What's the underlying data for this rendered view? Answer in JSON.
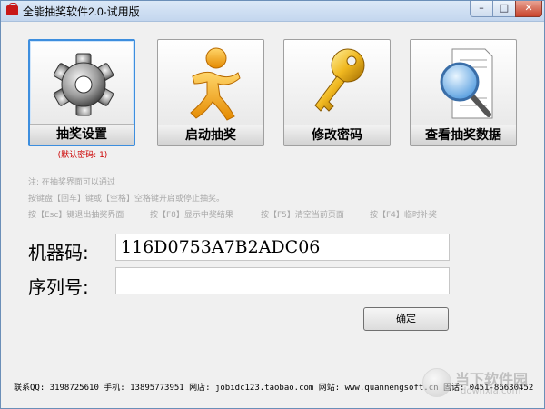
{
  "window": {
    "title": "全能抽奖软件2.0-试用版",
    "controls": {
      "minimize": "–",
      "maximize": "□",
      "close": "✕"
    }
  },
  "tiles": [
    {
      "label": "抽奖设置",
      "icon": "gear-icon",
      "selected": true
    },
    {
      "label": "启动抽奖",
      "icon": "running-man-icon"
    },
    {
      "label": "修改密码",
      "icon": "key-icon"
    },
    {
      "label": "查看抽奖数据",
      "icon": "magnifier-document-icon"
    }
  ],
  "default_password_hint": "(默认密码: 1)",
  "notes": {
    "line1": "注: 在抽奖界面可以通过",
    "line2": "按键盘【回车】键或【空格】空格键开启或停止抽奖。",
    "shortcuts": [
      "按【Esc】键退出抽奖界面",
      "按【F8】显示中奖结果",
      "按【F5】清空当前页面",
      "按【F4】临时补奖"
    ]
  },
  "form": {
    "machine_code_label": "机器码:",
    "machine_code_value": "116D0753A7B2ADC06",
    "serial_label": "序列号:",
    "serial_value": "",
    "confirm_label": "确定"
  },
  "footer": "联系QQ: 3198725610  手机: 13895773951  网店: jobidc123.taobao.com  网站: www.quannengsoft.cn  固话: 0451-86630452",
  "watermark": {
    "line1": "当下软件园",
    "line2": "downxia.com"
  },
  "colors": {
    "accent": "#3d8ede",
    "hint_red": "#cc0000",
    "note_gray": "#a8a8a8"
  }
}
